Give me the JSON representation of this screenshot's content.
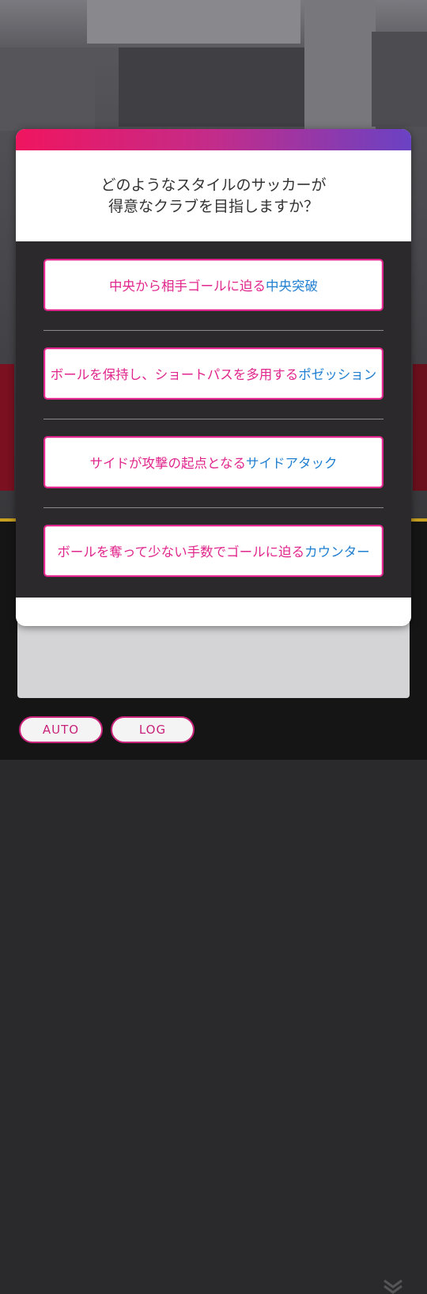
{
  "prompt": {
    "line1": "どのようなスタイルのサッカーが",
    "line2": "得意なクラブを目指しますか？"
  },
  "options": [
    {
      "desc": "中央から相手ゴールに迫る",
      "style": "中央突破"
    },
    {
      "desc": "ボールを保持し、ショートパスを多用する",
      "style": "ポゼッション"
    },
    {
      "desc": "サイドが攻撃の起点となる",
      "style": "サイドアタック"
    },
    {
      "desc": "ボールを奪って少ない手数でゴールに迫る",
      "style": "カウンター"
    }
  ],
  "controls": {
    "auto_label": "AUTO",
    "log_label": "LOG"
  },
  "colors": {
    "accent_pink": "#e0268c",
    "accent_blue": "#1f7fd0",
    "header_gradient": [
      "#f0155f",
      "#6a42c4"
    ]
  }
}
